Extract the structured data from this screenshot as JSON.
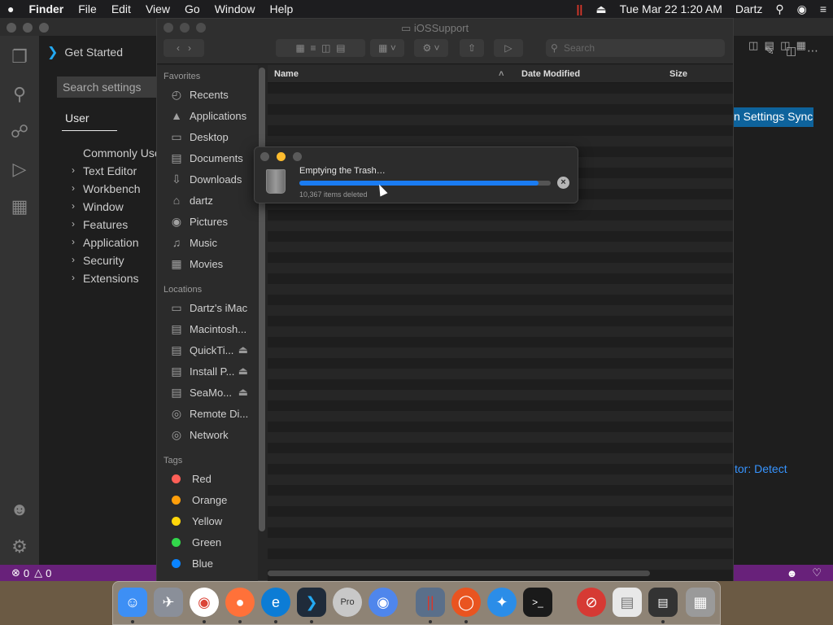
{
  "menubar": {
    "apple": "",
    "app_name": "Finder",
    "items": [
      "File",
      "Edit",
      "View",
      "Go",
      "Window",
      "Help"
    ],
    "datetime": "Tue Mar 22  1:20 AM",
    "user": "Dartz"
  },
  "vscode": {
    "tab_label": "Get Started",
    "search_placeholder": "Search settings",
    "scope_tab": "User",
    "tree": [
      "Commonly Used",
      "Text Editor",
      "Workbench",
      "Window",
      "Features",
      "Application",
      "Security",
      "Extensions"
    ],
    "sync_button": "n Settings Sync",
    "detect_link": "tor: Detect",
    "status": {
      "errors": "0",
      "warnings": "0"
    }
  },
  "finder": {
    "window_title": "iOSSupport",
    "search_placeholder": "Search",
    "favorites_header": "Favorites",
    "favorites": [
      {
        "label": "Recents",
        "icon": "clock-icon"
      },
      {
        "label": "Applications",
        "icon": "applications-icon"
      },
      {
        "label": "Desktop",
        "icon": "desktop-icon"
      },
      {
        "label": "Documents",
        "icon": "document-icon"
      },
      {
        "label": "Downloads",
        "icon": "download-icon"
      },
      {
        "label": "dartz",
        "icon": "home-icon"
      },
      {
        "label": "Pictures",
        "icon": "camera-icon"
      },
      {
        "label": "Music",
        "icon": "music-icon"
      },
      {
        "label": "Movies",
        "icon": "film-icon"
      }
    ],
    "locations_header": "Locations",
    "locations": [
      {
        "label": "Dartz's iMac",
        "icon": "imac-icon"
      },
      {
        "label": "Macintosh...",
        "icon": "disk-icon"
      },
      {
        "label": "QuickTi...",
        "icon": "disk-icon",
        "eject": "⏏"
      },
      {
        "label": "Install P...",
        "icon": "disk-icon",
        "eject": "⏏"
      },
      {
        "label": "SeaMo...",
        "icon": "disk-icon",
        "eject": "⏏"
      },
      {
        "label": "Remote Di...",
        "icon": "cd-icon"
      },
      {
        "label": "Network",
        "icon": "globe-icon"
      }
    ],
    "tags_header": "Tags",
    "tags": [
      {
        "label": "Red",
        "color": "#ff5f57"
      },
      {
        "label": "Orange",
        "color": "#ff9f0a"
      },
      {
        "label": "Yellow",
        "color": "#ffd60a"
      },
      {
        "label": "Green",
        "color": "#32d74b"
      },
      {
        "label": "Blue",
        "color": "#0a84ff"
      }
    ],
    "columns": {
      "name": "Name",
      "date": "Date Modified",
      "size": "Size"
    }
  },
  "trash_dialog": {
    "title": "Emptying the Trash…",
    "status": "10,367 items deleted",
    "progress": 0.95
  },
  "dock": [
    "Finder",
    "Launchpad",
    "Chrome",
    "Firefox",
    "Edge",
    "VS Code",
    "Pro",
    "Chromium",
    "Parallels",
    "Ubuntu",
    "Safari",
    "Terminal",
    "Stop",
    "Preview",
    "Console",
    "Trash"
  ]
}
